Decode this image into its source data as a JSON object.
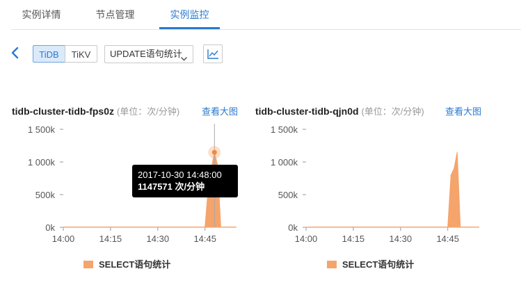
{
  "tabs": [
    {
      "label": "实例详情"
    },
    {
      "label": "节点管理"
    },
    {
      "label": "实例监控",
      "active": true
    }
  ],
  "toolbar": {
    "back_icon": "chevron-left-icon",
    "segments": [
      {
        "label": "TiDB",
        "selected": true
      },
      {
        "label": "TiKV",
        "selected": false
      }
    ],
    "metric_select": {
      "value": "UPDATE语句统计"
    },
    "chart_icon": "line-chart-icon"
  },
  "colors": {
    "accent": "#2a79cf",
    "series": "#f5a46c"
  },
  "charts": [
    {
      "title": "tidb-cluster-tidb-fps0z",
      "unit": "(单位：次/分钟)",
      "link": "查看大图",
      "legend": "SELECT语句统计",
      "tooltip": {
        "time": "2017-10-30 14:48:00",
        "value": "1147571 次/分钟"
      }
    },
    {
      "title": "tidb-cluster-tidb-qjn0d",
      "unit": "(单位：次/分钟)",
      "link": "查看大图",
      "legend": "SELECT语句统计"
    }
  ],
  "chart_data": [
    {
      "type": "area",
      "title": "tidb-cluster-tidb-fps0z",
      "ylabel": "(单位：次/分钟)",
      "x": [
        "14:00",
        "14:05",
        "14:10",
        "14:15",
        "14:20",
        "14:25",
        "14:30",
        "14:35",
        "14:40",
        "14:44",
        "14:45",
        "14:46",
        "14:47",
        "14:48",
        "14:49",
        "14:50",
        "14:51"
      ],
      "y": [
        0,
        0,
        0,
        0,
        0,
        0,
        0,
        0,
        0,
        0,
        0,
        600000,
        900000,
        1147571,
        950000,
        0,
        0
      ],
      "x_ticks": [
        "14:00",
        "14:15",
        "14:30",
        "14:45"
      ],
      "y_ticks": [
        "0k",
        "500k",
        "1 000k",
        "1 500k"
      ],
      "ylim": [
        0,
        1500000
      ],
      "grid": false,
      "series": [
        {
          "name": "SELECT语句统计"
        }
      ]
    },
    {
      "type": "area",
      "title": "tidb-cluster-tidb-qjn0d",
      "ylabel": "(单位：次/分钟)",
      "x": [
        "14:00",
        "14:05",
        "14:10",
        "14:15",
        "14:20",
        "14:25",
        "14:30",
        "14:35",
        "14:40",
        "14:44",
        "14:45",
        "14:46",
        "14:47",
        "14:48",
        "14:49",
        "14:50",
        "14:51"
      ],
      "y": [
        0,
        0,
        0,
        0,
        0,
        0,
        0,
        0,
        0,
        0,
        0,
        800000,
        900000,
        1150000,
        0,
        0,
        0
      ],
      "x_ticks": [
        "14:00",
        "14:15",
        "14:30",
        "14:45"
      ],
      "y_ticks": [
        "0k",
        "500k",
        "1 000k",
        "1 500k"
      ],
      "ylim": [
        0,
        1500000
      ],
      "grid": false,
      "series": [
        {
          "name": "SELECT语句统计"
        }
      ]
    }
  ]
}
